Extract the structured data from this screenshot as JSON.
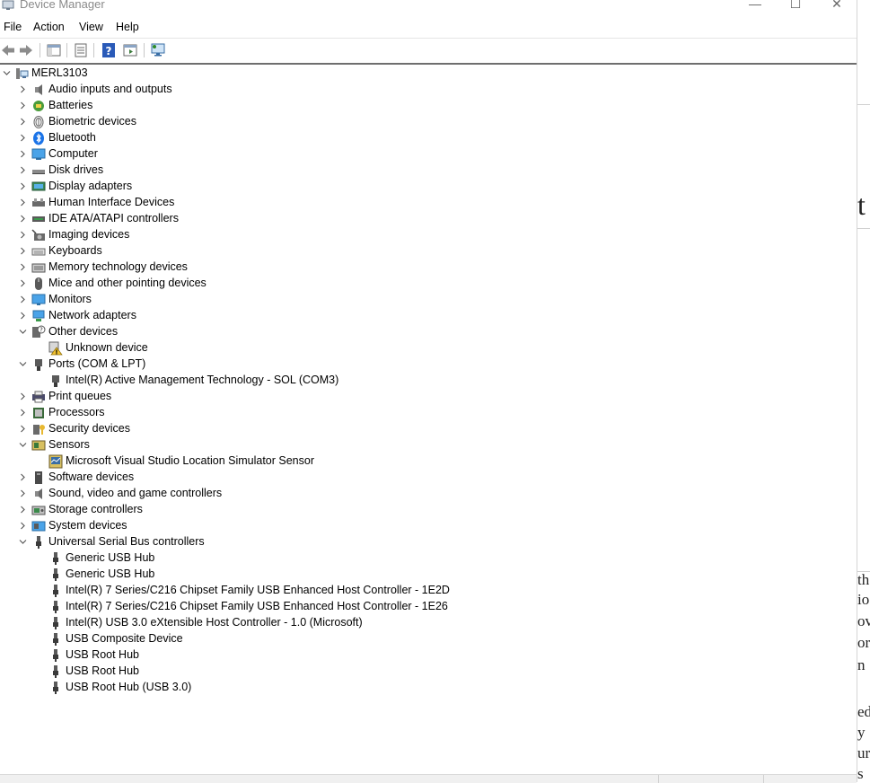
{
  "window": {
    "title": "Device Manager",
    "minimize": "—",
    "maximize": "☐",
    "close": "✕"
  },
  "menu": [
    "File",
    "Action",
    "View",
    "Help"
  ],
  "toolbar": [
    {
      "name": "back-button",
      "icon": "arrow-left-icon"
    },
    {
      "name": "forward-button",
      "icon": "arrow-right-icon"
    },
    {
      "name": "show-hide-console-tree-button",
      "icon": "console-tree-icon"
    },
    {
      "name": "properties-button",
      "icon": "properties-icon"
    },
    {
      "name": "help-button",
      "icon": "help-icon"
    },
    {
      "name": "action-pane-button",
      "icon": "action-pane-icon"
    },
    {
      "name": "scan-hardware-button",
      "icon": "monitor-scan-icon"
    }
  ],
  "tree": {
    "root": "MERL3103",
    "items": [
      {
        "label": "Audio inputs and outputs",
        "icon": "speaker-icon",
        "expanded": false,
        "children": []
      },
      {
        "label": "Batteries",
        "icon": "battery-icon",
        "expanded": false,
        "children": []
      },
      {
        "label": "Biometric devices",
        "icon": "fingerprint-icon",
        "expanded": false,
        "children": []
      },
      {
        "label": "Bluetooth",
        "icon": "bluetooth-icon",
        "expanded": false,
        "children": []
      },
      {
        "label": "Computer",
        "icon": "computer-icon",
        "expanded": false,
        "children": []
      },
      {
        "label": "Disk drives",
        "icon": "disk-icon",
        "expanded": false,
        "children": []
      },
      {
        "label": "Display adapters",
        "icon": "display-adapter-icon",
        "expanded": false,
        "children": []
      },
      {
        "label": "Human Interface Devices",
        "icon": "hid-icon",
        "expanded": false,
        "children": []
      },
      {
        "label": "IDE ATA/ATAPI controllers",
        "icon": "ide-controller-icon",
        "expanded": false,
        "children": []
      },
      {
        "label": "Imaging devices",
        "icon": "camera-icon",
        "expanded": false,
        "children": []
      },
      {
        "label": "Keyboards",
        "icon": "keyboard-icon",
        "expanded": false,
        "children": []
      },
      {
        "label": "Memory technology devices",
        "icon": "memory-icon",
        "expanded": false,
        "children": []
      },
      {
        "label": "Mice and other pointing devices",
        "icon": "mouse-icon",
        "expanded": false,
        "children": []
      },
      {
        "label": "Monitors",
        "icon": "monitor-icon",
        "expanded": false,
        "children": []
      },
      {
        "label": "Network adapters",
        "icon": "network-icon",
        "expanded": false,
        "children": []
      },
      {
        "label": "Other devices",
        "icon": "unknown-device-icon",
        "expanded": true,
        "children": [
          {
            "label": "Unknown device",
            "icon": "warning-device-icon"
          }
        ]
      },
      {
        "label": "Ports (COM & LPT)",
        "icon": "port-icon",
        "expanded": true,
        "children": [
          {
            "label": "Intel(R) Active Management Technology - SOL (COM3)",
            "icon": "port-icon"
          }
        ]
      },
      {
        "label": "Print queues",
        "icon": "printer-icon",
        "expanded": false,
        "children": []
      },
      {
        "label": "Processors",
        "icon": "processor-icon",
        "expanded": false,
        "children": []
      },
      {
        "label": "Security devices",
        "icon": "security-key-icon",
        "expanded": false,
        "children": []
      },
      {
        "label": "Sensors",
        "icon": "sensor-icon",
        "expanded": true,
        "children": [
          {
            "label": "Microsoft Visual Studio Location Simulator Sensor",
            "icon": "sensor-chip-icon"
          }
        ]
      },
      {
        "label": "Software devices",
        "icon": "software-device-icon",
        "expanded": false,
        "children": []
      },
      {
        "label": "Sound, video and game controllers",
        "icon": "speaker-icon",
        "expanded": false,
        "children": []
      },
      {
        "label": "Storage controllers",
        "icon": "storage-controller-icon",
        "expanded": false,
        "children": []
      },
      {
        "label": "System devices",
        "icon": "system-device-icon",
        "expanded": false,
        "children": []
      },
      {
        "label": "Universal Serial Bus controllers",
        "icon": "usb-icon",
        "expanded": true,
        "children": [
          {
            "label": "Generic USB Hub",
            "icon": "usb-icon"
          },
          {
            "label": "Generic USB Hub",
            "icon": "usb-icon"
          },
          {
            "label": "Intel(R) 7 Series/C216 Chipset Family USB Enhanced Host Controller - 1E2D",
            "icon": "usb-icon"
          },
          {
            "label": "Intel(R) 7 Series/C216 Chipset Family USB Enhanced Host Controller - 1E26",
            "icon": "usb-icon"
          },
          {
            "label": "Intel(R) USB 3.0 eXtensible Host Controller - 1.0 (Microsoft)",
            "icon": "usb-icon"
          },
          {
            "label": "USB Composite Device",
            "icon": "usb-icon"
          },
          {
            "label": "USB Root Hub",
            "icon": "usb-icon"
          },
          {
            "label": "USB Root Hub",
            "icon": "usb-icon"
          },
          {
            "label": "USB Root Hub (USB 3.0)",
            "icon": "usb-icon"
          }
        ]
      }
    ]
  },
  "background_fragments": [
    "t",
    "th",
    "io",
    "ov",
    "or",
    "n",
    "ed",
    "y",
    "ur",
    "s"
  ]
}
